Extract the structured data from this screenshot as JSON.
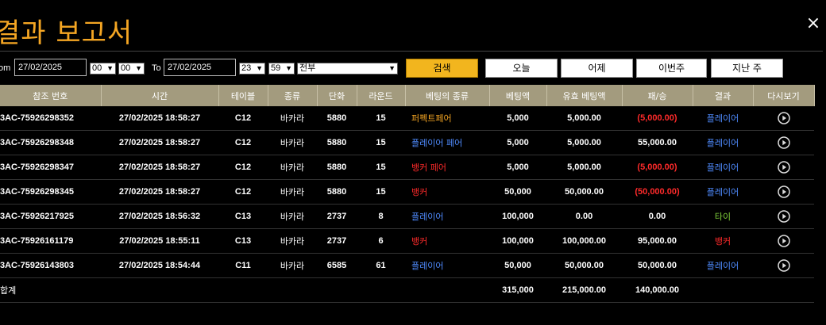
{
  "title": "결과 보고서",
  "close_label": "×",
  "filters": {
    "from_label": "om",
    "from_date": "27/02/2025",
    "from_hour": "00",
    "from_min": "00",
    "to_label": "To",
    "to_date": "27/02/2025",
    "to_hour": "23",
    "to_min": "59",
    "type_select": "전부",
    "search_label": "검색",
    "today_label": "오늘",
    "yesterday_label": "어제",
    "this_week_label": "이번주",
    "last_week_label": "지난 주"
  },
  "columns": [
    "참조 번호",
    "시간",
    "테이블",
    "종류",
    "단화",
    "라운드",
    "베팅의 종류",
    "베팅액",
    "유효 베팅액",
    "패/승",
    "결과",
    "다시보기"
  ],
  "rows": [
    {
      "ref": "3AC-75926298352",
      "time": "27/02/2025 18:58:27",
      "table": "C12",
      "game": "바카라",
      "shoe": "5880",
      "round": "15",
      "bet_type": "퍼펙트페어",
      "bet_color": "perfect",
      "bet": "5,000",
      "valid": "5,000.00",
      "winloss": "(5,000.00)",
      "winloss_neg": true,
      "result": "플레이어",
      "result_color": "player"
    },
    {
      "ref": "3AC-75926298348",
      "time": "27/02/2025 18:58:27",
      "table": "C12",
      "game": "바카라",
      "shoe": "5880",
      "round": "15",
      "bet_type": "플레이어 페어",
      "bet_color": "player",
      "bet": "5,000",
      "valid": "5,000.00",
      "winloss": "55,000.00",
      "winloss_neg": false,
      "result": "플레이어",
      "result_color": "player"
    },
    {
      "ref": "3AC-75926298347",
      "time": "27/02/2025 18:58:27",
      "table": "C12",
      "game": "바카라",
      "shoe": "5880",
      "round": "15",
      "bet_type": "뱅커 페어",
      "bet_color": "banker",
      "bet": "5,000",
      "valid": "5,000.00",
      "winloss": "(5,000.00)",
      "winloss_neg": true,
      "result": "플레이어",
      "result_color": "player"
    },
    {
      "ref": "3AC-75926298345",
      "time": "27/02/2025 18:58:27",
      "table": "C12",
      "game": "바카라",
      "shoe": "5880",
      "round": "15",
      "bet_type": "뱅커",
      "bet_color": "banker",
      "bet": "50,000",
      "valid": "50,000.00",
      "winloss": "(50,000.00)",
      "winloss_neg": true,
      "result": "플레이어",
      "result_color": "player"
    },
    {
      "ref": "3AC-75926217925",
      "time": "27/02/2025 18:56:32",
      "table": "C13",
      "game": "바카라",
      "shoe": "2737",
      "round": "8",
      "bet_type": "플레이어",
      "bet_color": "player",
      "bet": "100,000",
      "valid": "0.00",
      "winloss": "0.00",
      "winloss_neg": false,
      "result": "타이",
      "result_color": "tie"
    },
    {
      "ref": "3AC-75926161179",
      "time": "27/02/2025 18:55:11",
      "table": "C13",
      "game": "바카라",
      "shoe": "2737",
      "round": "6",
      "bet_type": "뱅커",
      "bet_color": "banker",
      "bet": "100,000",
      "valid": "100,000.00",
      "winloss": "95,000.00",
      "winloss_neg": false,
      "result": "뱅커",
      "result_color": "banker"
    },
    {
      "ref": "3AC-75926143803",
      "time": "27/02/2025 18:54:44",
      "table": "C11",
      "game": "바카라",
      "shoe": "6585",
      "round": "61",
      "bet_type": "플레이어",
      "bet_color": "player",
      "bet": "50,000",
      "valid": "50,000.00",
      "winloss": "50,000.00",
      "winloss_neg": false,
      "result": "플레이어",
      "result_color": "player"
    }
  ],
  "totals": {
    "label": "합계",
    "bet": "315,000",
    "valid": "215,000.00",
    "winloss": "140,000.00"
  },
  "colors": {
    "title": "#f5a623",
    "header_bg": "#a39b7e",
    "player": "#4f8bff",
    "banker": "#ff2a2a",
    "tie": "#7fcf3a",
    "perfect": "#f5a623",
    "search_button": "#f2b51e"
  },
  "icons": {
    "replay": "play-circle-icon",
    "close": "close-icon"
  }
}
